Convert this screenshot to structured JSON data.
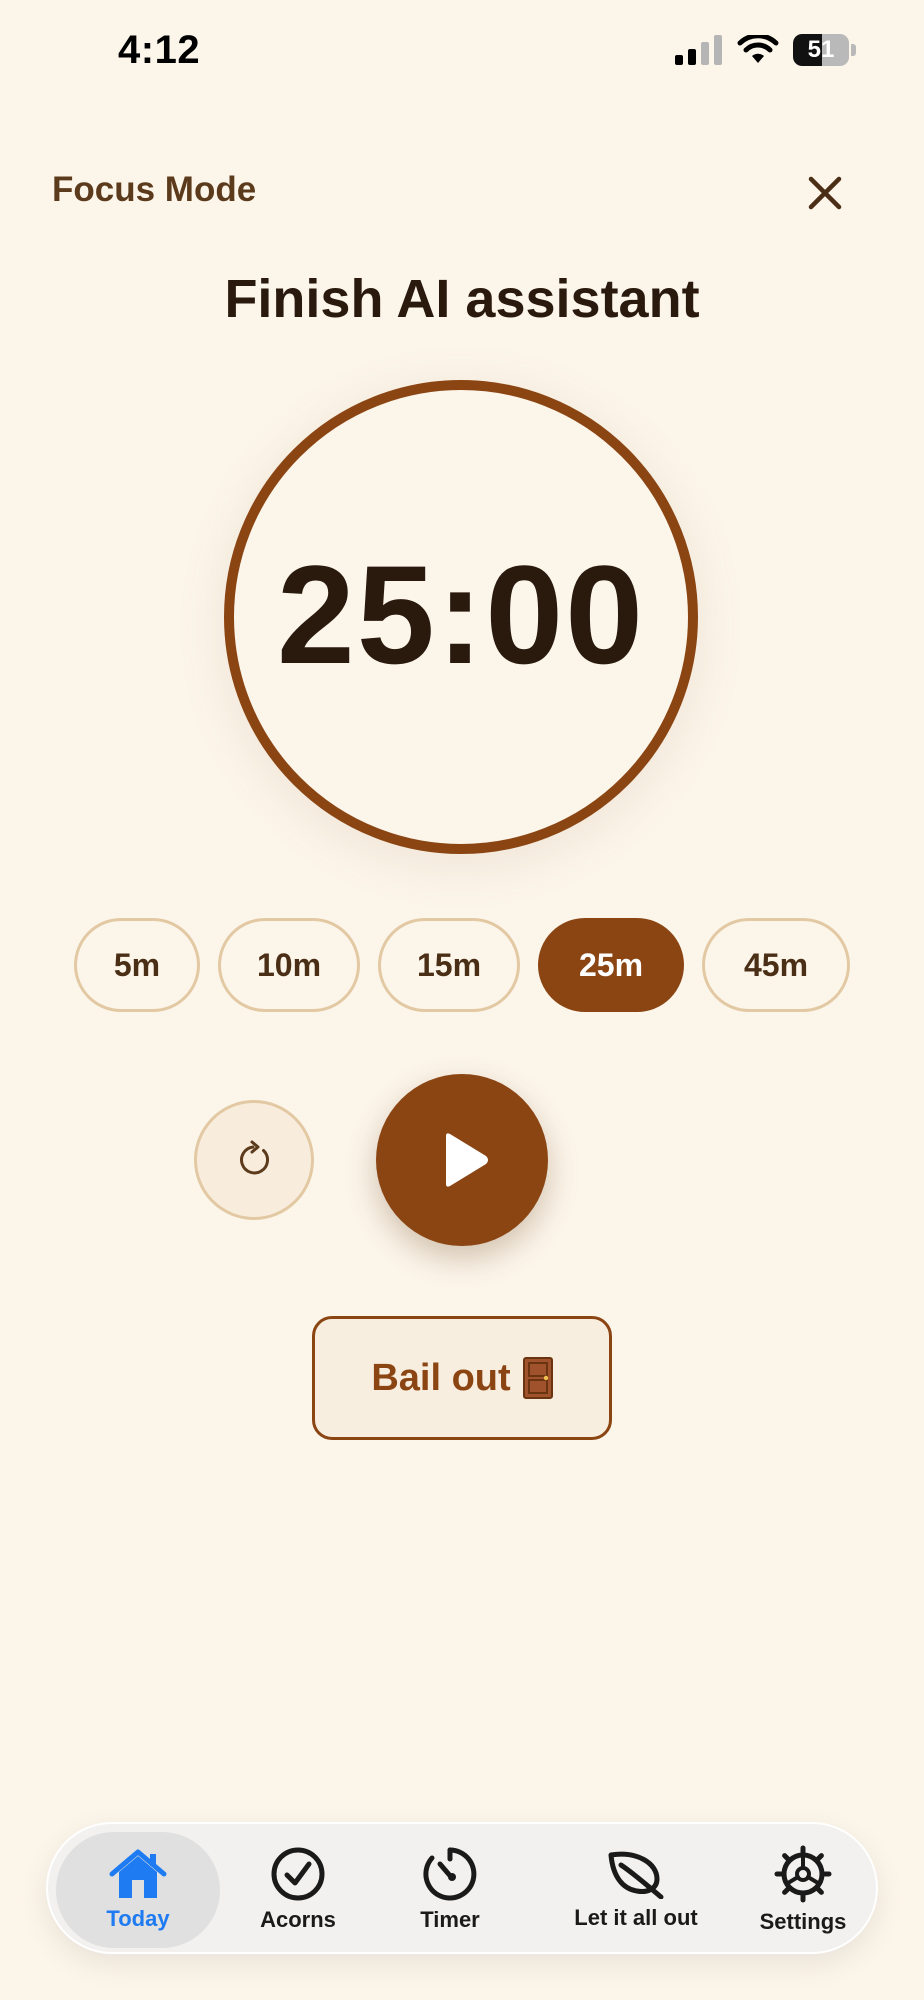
{
  "status_bar": {
    "time": "4:12",
    "battery_percent": "51",
    "battery_level": 0.51
  },
  "header": {
    "title": "Focus Mode",
    "close_icon": "close-icon"
  },
  "task": {
    "title": "Finish AI assistant"
  },
  "timer": {
    "display": "25:00"
  },
  "durations": [
    {
      "label": "5m",
      "selected": false
    },
    {
      "label": "10m",
      "selected": false
    },
    {
      "label": "15m",
      "selected": false
    },
    {
      "label": "25m",
      "selected": true
    },
    {
      "label": "45m",
      "selected": false
    }
  ],
  "controls": {
    "reset_icon": "reset-icon",
    "play_icon": "play-icon"
  },
  "bail_out": {
    "label": "Bail out",
    "emoji": "🚪"
  },
  "tabbar": {
    "active_color": "#1E7BF2",
    "tabs": [
      {
        "label": "Today",
        "icon": "house-icon",
        "active": true
      },
      {
        "label": "Acorns",
        "icon": "checkmark-circle-icon",
        "active": false
      },
      {
        "label": "Timer",
        "icon": "timer-icon",
        "active": false
      },
      {
        "label": "Let it all out",
        "icon": "leaf-icon",
        "active": false
      },
      {
        "label": "Settings",
        "icon": "gear-icon",
        "active": false
      }
    ]
  },
  "colors": {
    "accent": "#8B4513",
    "background": "#FCF5EA",
    "chip_border": "#E3C9A3"
  }
}
